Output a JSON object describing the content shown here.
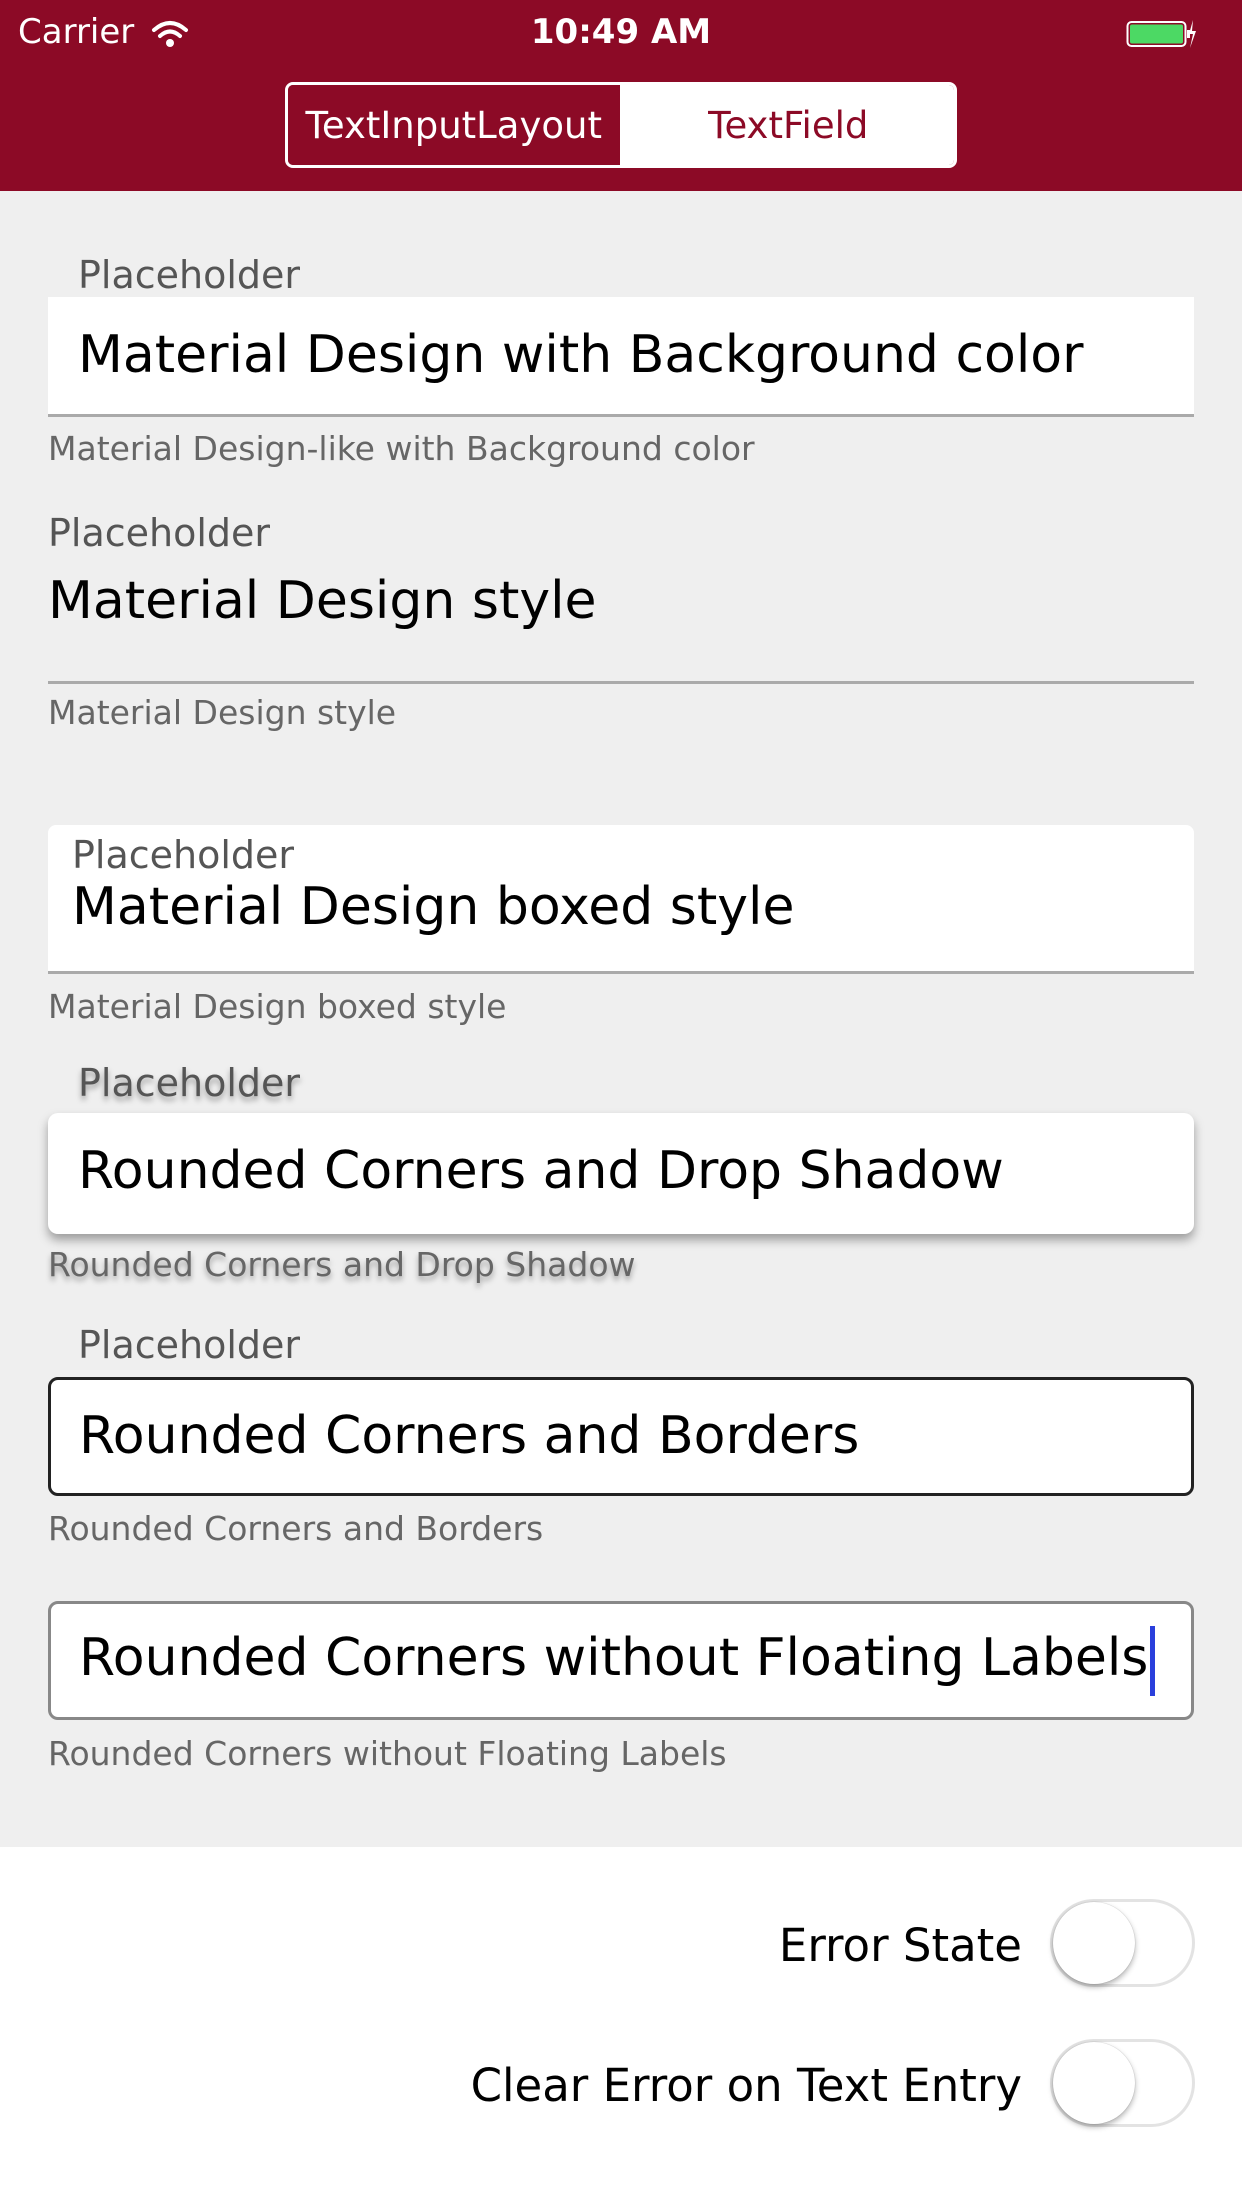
{
  "status_bar": {
    "carrier": "Carrier",
    "time": "10:49 AM",
    "wifi_icon": "wifi-icon",
    "battery_icon": "battery-charging-icon",
    "battery_color": "#4cd964"
  },
  "segmented_control": {
    "items": [
      "TextInputLayout",
      "TextField"
    ],
    "selected": "TextInputLayout"
  },
  "fields": [
    {
      "placeholder": "Placeholder",
      "value": "Material Design with Background color",
      "helper": "Material Design-like with Background color"
    },
    {
      "placeholder": "Placeholder",
      "value": "Material Design style",
      "helper": "Material Design style"
    },
    {
      "placeholder": "Placeholder",
      "value": "Material Design boxed style",
      "helper": "Material Design boxed style"
    },
    {
      "placeholder": "Placeholder",
      "value": "Rounded Corners and Drop Shadow",
      "helper": "Rounded Corners and Drop Shadow"
    },
    {
      "placeholder": "Placeholder",
      "value": "Rounded Corners and Borders",
      "helper": "Rounded Corners and Borders"
    },
    {
      "value": "Rounded Corners without Floating Labels",
      "helper": "Rounded Corners without Floating Labels"
    }
  ],
  "toggles": [
    {
      "label": "Error State",
      "on": false
    },
    {
      "label": "Clear Error on Text Entry",
      "on": false
    }
  ],
  "colors": {
    "brand": "#8c0a26",
    "background": "#efefef",
    "cursor": "#2a3fdc"
  }
}
